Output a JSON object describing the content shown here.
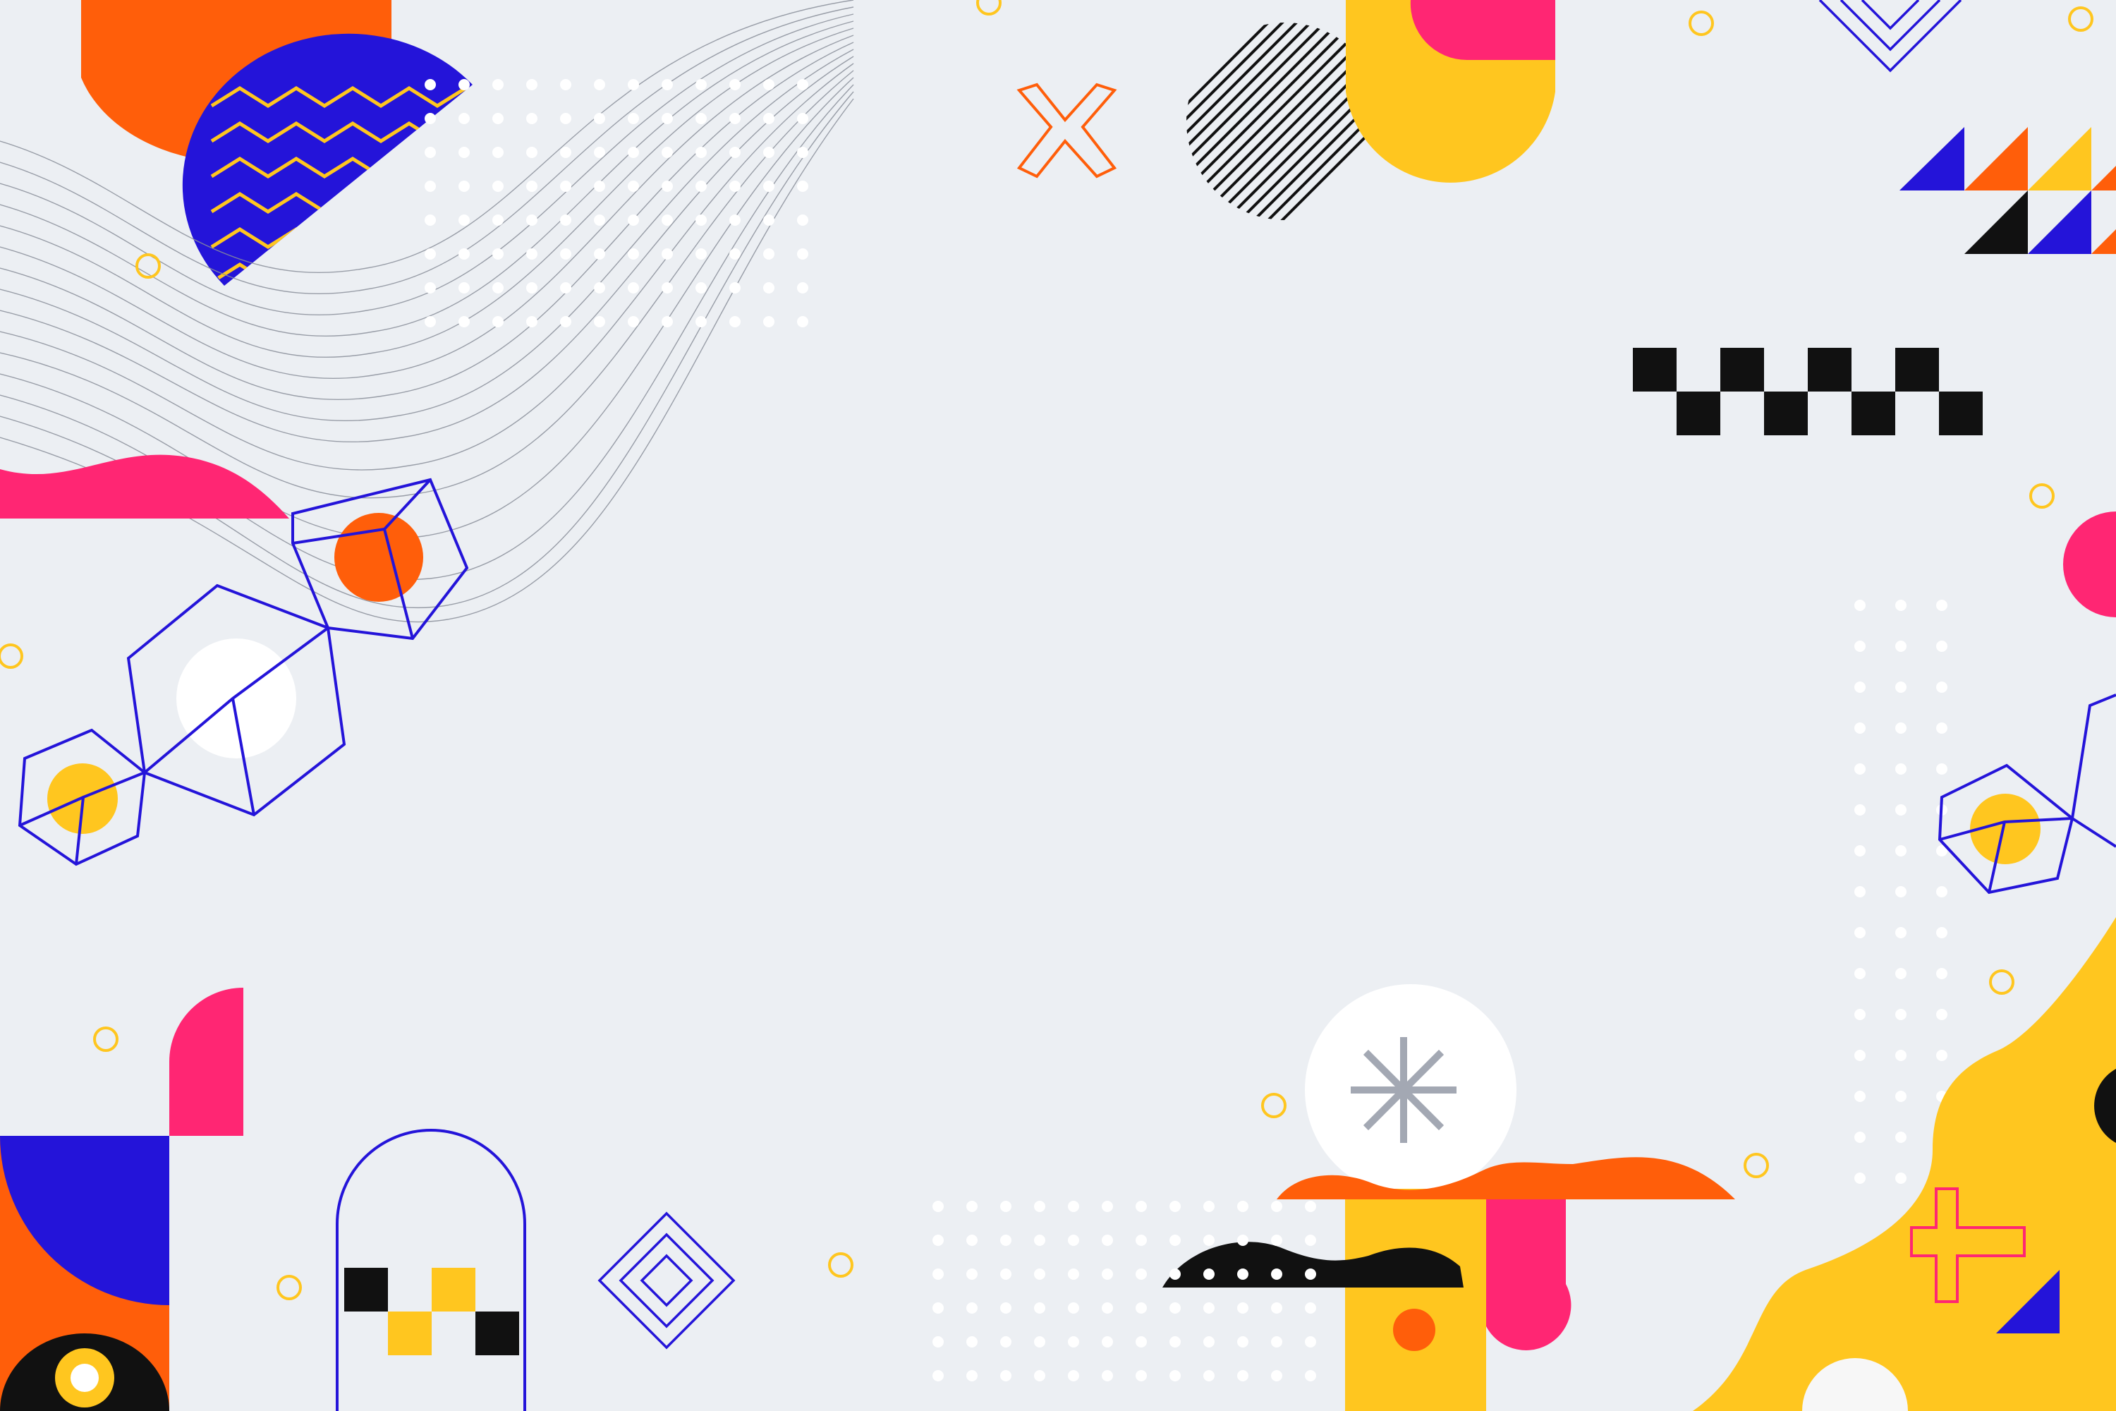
{
  "scene": {
    "description_free": true,
    "background": "#ECEFF3",
    "palette": {
      "orange": "#FF5E0A",
      "pink": "#FF2673",
      "yellow": "#FFC61F",
      "blue": "#2414D9",
      "black": "#111111",
      "white": "#FFFFFF",
      "grey": "#A3A8B3",
      "line_grey": "#8A8F9A",
      "dot": "#FFFFFF"
    }
  },
  "elements": [
    {
      "name": "orange-half-circle",
      "icon": "circle-shape"
    },
    {
      "name": "zigzag-pattern-semicircle",
      "icon": "zigzag-shape"
    },
    {
      "name": "contour-lines-wave",
      "icon": "wave-lines"
    },
    {
      "name": "hatched-circle",
      "icon": "striped-circle"
    },
    {
      "name": "yellow-arch-block",
      "icon": "arch-shape"
    },
    {
      "name": "orange-cross-outline",
      "icon": "x-icon"
    },
    {
      "name": "triangle-grid",
      "icon": "triangles"
    },
    {
      "name": "checker-strip",
      "icon": "checkerboard"
    },
    {
      "name": "wireframe-cubes",
      "icon": "cube-outline"
    },
    {
      "name": "blob-yellow",
      "icon": "blob-shape"
    },
    {
      "name": "asterisk-circle",
      "icon": "asterisk-icon"
    },
    {
      "name": "plus-outline",
      "icon": "plus-icon"
    },
    {
      "name": "spiral-diamond",
      "icon": "diamond-spiral"
    },
    {
      "name": "arch-outline",
      "icon": "arch-outline"
    }
  ]
}
